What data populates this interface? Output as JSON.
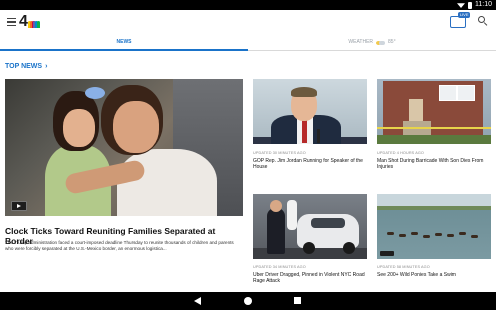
{
  "status_bar": {
    "time": "11:10"
  },
  "app": {
    "logo_text": "4",
    "peacock_colors": [
      "#fccb0a",
      "#f37021",
      "#cc004c",
      "#6460aa",
      "#0089d0",
      "#0db14b"
    ],
    "live_badge": "LIVE"
  },
  "tabs": {
    "news": "NEWS",
    "weather": "WEATHER",
    "temp": "85°"
  },
  "section": {
    "title": "TOP NEWS",
    "chevron": "›"
  },
  "hero": {
    "title": "Clock Ticks Toward Reuniting Families Separated at Border",
    "summary": "The Trump administration faced a court-imposed deadline Thursday to reunite thousands of children and parents who were forcibly separated at the U.S.-Mexico border, an enormous logistica..."
  },
  "cards": [
    {
      "updated": "UPDATED 30 MINUTES AGO",
      "title": "GOP Rep. Jim Jordan Running for Speaker of the House"
    },
    {
      "updated": "UPDATED 4 HOURS AGO",
      "title": "Man Shot During Barricade With Son Dies From Injuries"
    },
    {
      "updated": "UPDATED 34 MINUTES AGO",
      "title": "Uber Driver Dragged, Pinned in Violent NYC Road Rage Attack"
    },
    {
      "updated": "UPDATED 58 MINUTES AGO",
      "title": "See 200+ Wild Ponies Take a Swim"
    }
  ],
  "colors": {
    "accent": "#1a73c9",
    "tab_inactive": "#9aa1a8"
  }
}
